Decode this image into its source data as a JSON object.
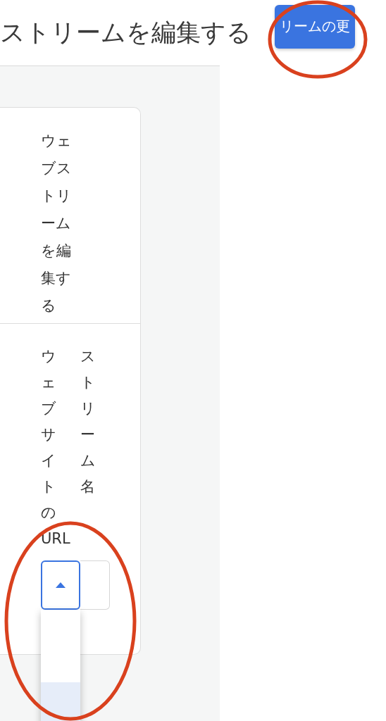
{
  "header": {
    "title": "ストリームを編集する",
    "button": "リームの更"
  },
  "card": {
    "heading": "ウェブストリームを編集する",
    "labels": [
      "ウェブサイトのURL",
      "ストリーム名"
    ],
    "select": {
      "expanded": true,
      "options": [
        {
          "selected": false
        },
        {
          "selected": true
        }
      ]
    }
  },
  "annotations": [
    {
      "kind": "circle"
    },
    {
      "kind": "circle"
    }
  ]
}
